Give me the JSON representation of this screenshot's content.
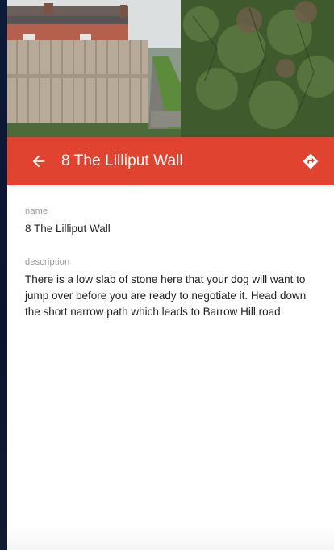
{
  "header": {
    "title": "8 The Lilliput Wall",
    "back_icon": "arrow-left-icon",
    "directions_icon": "directions-icon",
    "bar_color": "#e0432f"
  },
  "details": {
    "name_label": "name",
    "name_value": "8 The Lilliput Wall",
    "description_label": "description",
    "description_value": "There is a low slab of stone here that your dog will want to jump over before you are ready to negotiate it. Head down the short narrow path which leads to Barrow Hill road."
  }
}
